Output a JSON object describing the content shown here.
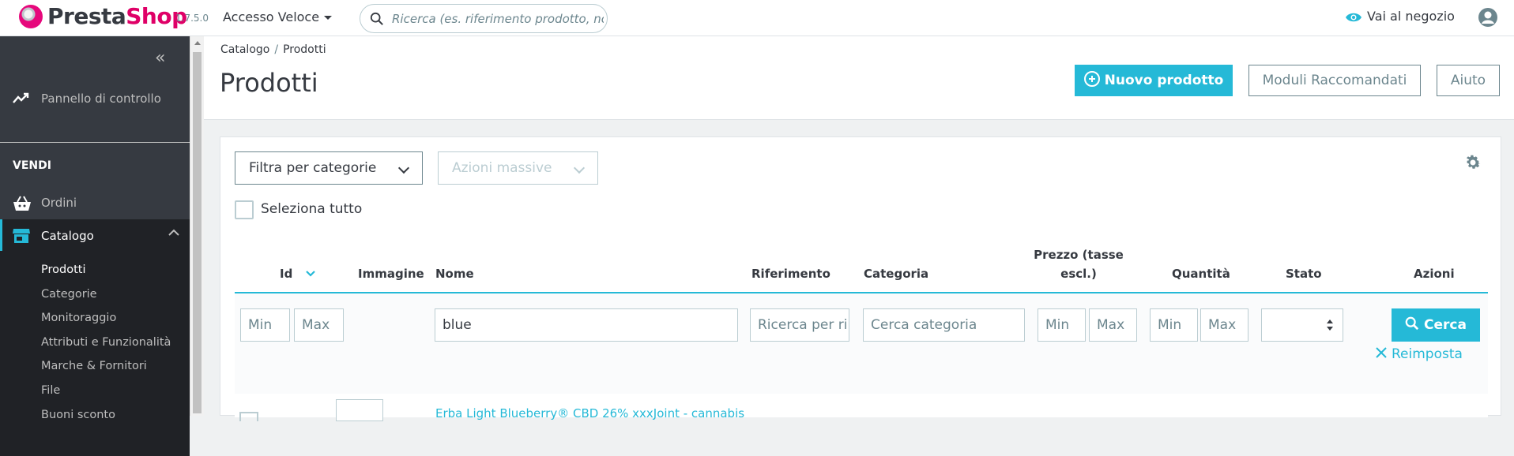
{
  "header": {
    "brand_presta": "Presta",
    "brand_shop": "Shop",
    "version": "1.7.5.0",
    "quick_access": "Accesso Veloce",
    "search_placeholder": "Ricerca (es. riferimento prodotto, nome",
    "shop_link": "Vai al negozio",
    "accent_color": "#25b9d7",
    "brand_color": "#df0067"
  },
  "sidebar": {
    "collapse_icon": "«",
    "dashboard": "Pannello di controllo",
    "section_sell": "VENDI",
    "orders": "Ordini",
    "catalog": "Catalogo",
    "submenu": [
      "Prodotti",
      "Categorie",
      "Monitoraggio",
      "Attributi e Funzionalità",
      "Marche & Fornitori",
      "File",
      "Buoni sconto"
    ]
  },
  "page": {
    "breadcrumb": [
      "Catalogo",
      "Prodotti"
    ],
    "breadcrumb_sep": "/",
    "title": "Prodotti",
    "buttons": {
      "new_product": "Nuovo prodotto",
      "modules": "Moduli Raccomandati",
      "help": "Aiuto"
    }
  },
  "toolbar": {
    "filter_categories": "Filtra per categorie",
    "bulk_actions": "Azioni massive",
    "select_all": "Seleziona tutto"
  },
  "table": {
    "headers": {
      "id": "Id",
      "image": "Immagine",
      "name": "Nome",
      "reference": "Riferimento",
      "category": "Categoria",
      "price_line1": "Prezzo (tasse",
      "price_line2": "escl.)",
      "quantity": "Quantità",
      "status": "Stato",
      "actions": "Azioni"
    },
    "filters": {
      "id_min": "Min",
      "id_max": "Max",
      "name_value": "blue",
      "reference_placeholder": "Ricerca per ri",
      "category_placeholder": "Cerca categoria",
      "price_min": "Min",
      "price_max": "Max",
      "qty_min": "Min",
      "qty_max": "Max",
      "search_button": "Cerca",
      "reset": "Reimposta"
    },
    "rows": [
      {
        "name": "Erba Light Blueberry® CBD 26% xxxJoint - cannabis"
      }
    ]
  }
}
